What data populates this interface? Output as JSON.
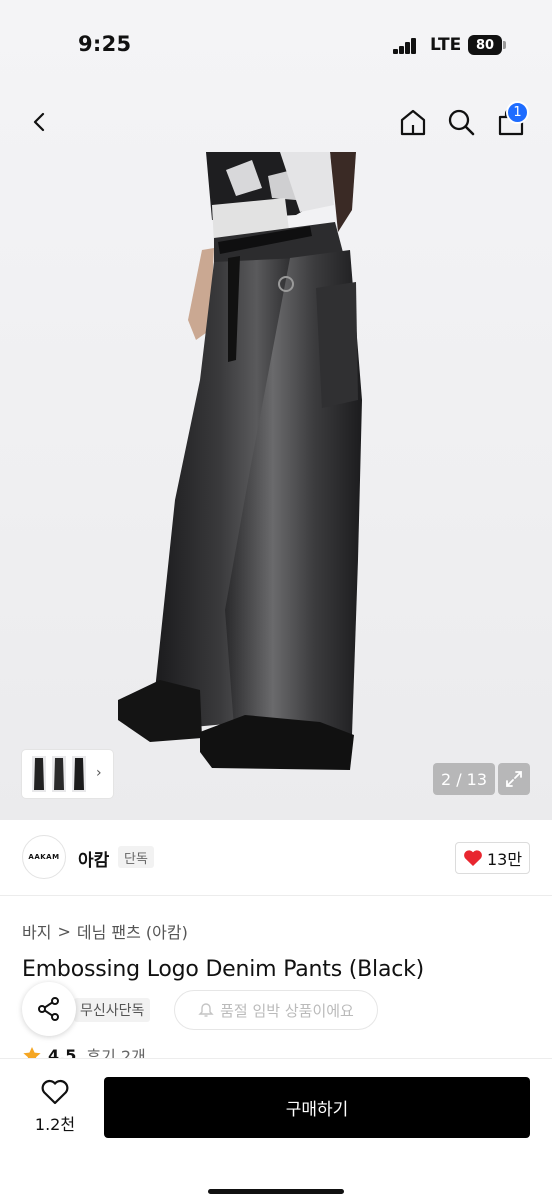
{
  "status_bar": {
    "time": "9:25",
    "network": "LTE",
    "battery": "80"
  },
  "nav": {
    "cart_count": "1"
  },
  "gallery": {
    "counter": "2 / 13"
  },
  "brand": {
    "logo_text": "AAKAM",
    "name": "아캄",
    "tag": "단독",
    "likes": "13만"
  },
  "breadcrumb": {
    "level1": "바지",
    "separator": ">",
    "level2": "데님 팬츠 (아캄)"
  },
  "product": {
    "title": "Embossing Logo Denim Pants (Black)",
    "exclusive_tag": "무신사단독",
    "restock_label": "품절 임박 상품이에요",
    "rating": "4.5",
    "reviews": "후기 2개"
  },
  "bottom": {
    "wish_count": "1.2천",
    "buy_label": "구매하기"
  },
  "colors": {
    "accent_blue": "#1e6cff",
    "heart_red": "#e8262f",
    "star_orange": "#f5a623",
    "primary_black": "#000000"
  }
}
